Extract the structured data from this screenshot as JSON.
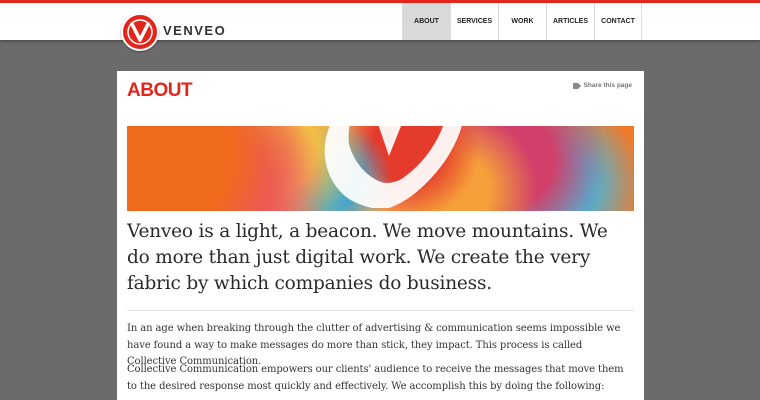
{
  "header": {
    "brand": "VENVEO",
    "nav": [
      {
        "label": "ABOUT",
        "active": true
      },
      {
        "label": "SERVICES",
        "active": false
      },
      {
        "label": "WORK",
        "active": false
      },
      {
        "label": "ARTICLES",
        "active": false
      },
      {
        "label": "CONTACT",
        "active": false
      }
    ]
  },
  "page": {
    "title": "ABOUT",
    "share_label": "Share this page",
    "lead": "Venveo is a light, a beacon. We move mountains. We do more than just digital work. We create the very fabric by which companies do business.",
    "paragraphs": [
      "In an age when breaking through the clutter of advertising & communication seems impossible we have found a way to make messages do more than stick, they impact. This process is called Collective Communication.",
      "Collective Communication empowers our clients' audience to receive the messages that move them to the desired response most quickly and effectively. We accomplish this by doing the following:"
    ]
  },
  "colors": {
    "accent": "#e2261c",
    "background": "#6b6b6b"
  },
  "icons": [
    "venveo-logo-icon",
    "share-icon"
  ]
}
